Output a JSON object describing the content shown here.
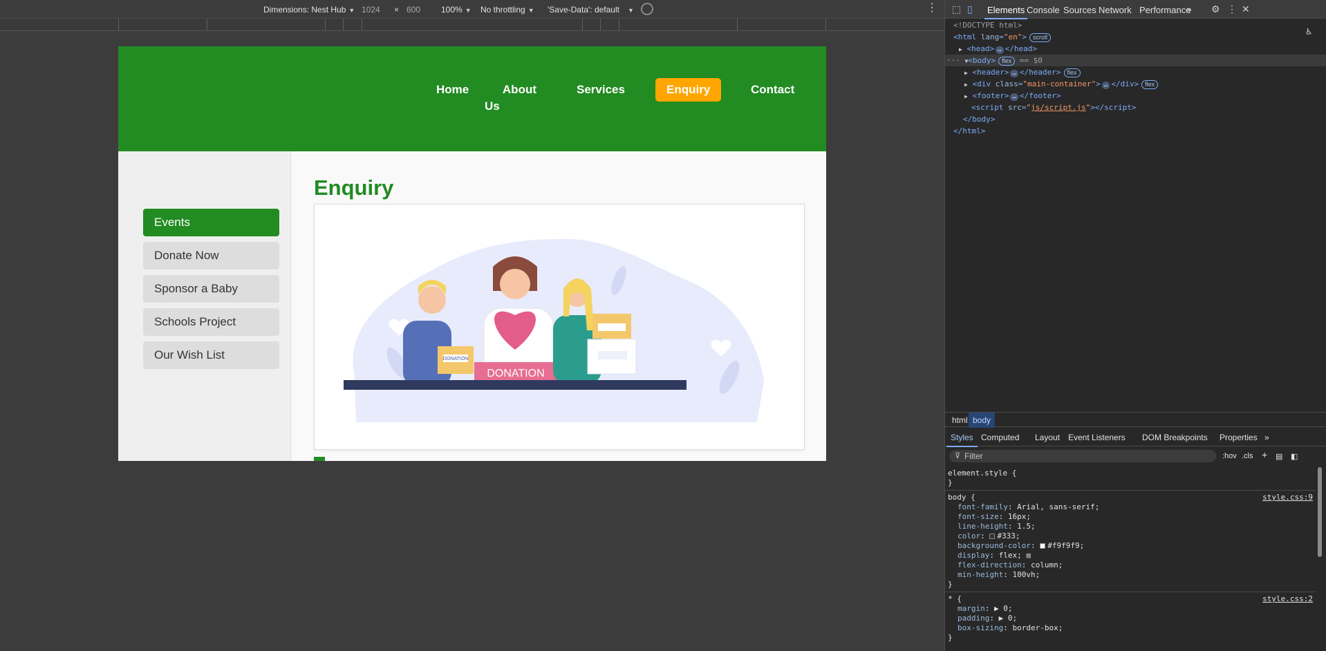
{
  "device_toolbar": {
    "dimensions_label": "Dimensions: Nest Hub",
    "width": "1024",
    "times": "×",
    "height": "600",
    "zoom": "100%",
    "throttling": "No throttling",
    "save_data": "'Save-Data': default"
  },
  "site": {
    "nav": {
      "home": "Home",
      "about_line1": "About",
      "about_line2": "Us",
      "services": "Services",
      "enquiry": "Enquiry",
      "contact": "Contact"
    },
    "sidebar": [
      {
        "label": "Events",
        "active": true
      },
      {
        "label": "Donate Now",
        "active": false
      },
      {
        "label": "Sponsor a Baby",
        "active": false
      },
      {
        "label": "Schools Project",
        "active": false
      },
      {
        "label": "Our Wish List",
        "active": false
      }
    ],
    "main": {
      "title": "Enquiry",
      "illustration": {
        "box_label_small": "DONATION",
        "banner_text": "DONATION"
      }
    }
  },
  "devtools": {
    "tabs": [
      "Elements",
      "Console",
      "Sources",
      "Network",
      "Performance"
    ],
    "active_tab": "Elements",
    "dom": {
      "doctype": "<!DOCTYPE html>",
      "html_tag": "html",
      "html_attr": "lang",
      "html_val": "\"en\"",
      "scroll_badge": "scroll",
      "head": "head",
      "body": "body",
      "flex_badge": "flex",
      "sel_marker": "== $0",
      "header": "header",
      "div_attr": "class",
      "div_val": "\"main-container\"",
      "footer": "footer",
      "script_attr": "src",
      "script_val": "js/script.js",
      "close_body": "</body>",
      "close_html": "</html>",
      "ellipsis": "…",
      "dots": "···"
    },
    "breadcrumb": [
      "html",
      "body"
    ],
    "styles_tabs": [
      "Styles",
      "Computed",
      "Layout",
      "Event Listeners",
      "DOM Breakpoints",
      "Properties"
    ],
    "filter_placeholder": "Filter",
    "filter_hov": ":hov",
    "filter_cls": ".cls",
    "rules": {
      "element_style": "element.style {",
      "close": "}",
      "body_selector": "body {",
      "body_source": "style.css:9",
      "body_props": [
        {
          "prop": "font-family",
          "value": "Arial, sans-serif;"
        },
        {
          "prop": "font-size",
          "value": "16px;"
        },
        {
          "prop": "line-height",
          "value": "1.5;"
        },
        {
          "prop": "color",
          "value": "#333;"
        },
        {
          "prop": "background-color",
          "value": "#f9f9f9;"
        },
        {
          "prop": "display",
          "value": "flex;"
        },
        {
          "prop": "flex-direction",
          "value": "column;"
        },
        {
          "prop": "min-height",
          "value": "100vh;"
        }
      ],
      "star_selector": "* {",
      "star_source": "style.css:2",
      "star_props": [
        {
          "prop": "margin",
          "value": "▶ 0;"
        },
        {
          "prop": "padding",
          "value": "▶ 0;"
        },
        {
          "prop": "box-sizing",
          "value": "border-box;"
        }
      ]
    }
  },
  "colors": {
    "brand_green": "#228b22",
    "enquiry_orange": "#ffa500",
    "page_bg": "#f9f9f9",
    "sidebar_btn": "#dddddd"
  }
}
